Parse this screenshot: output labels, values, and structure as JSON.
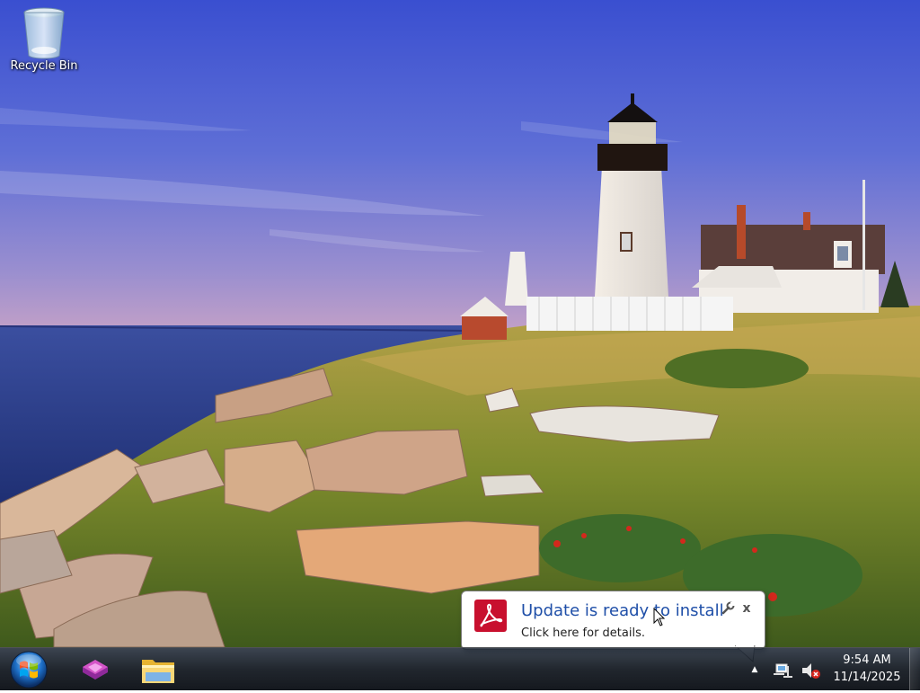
{
  "desktop": {
    "icons": [
      {
        "label": "Recycle Bin",
        "icon": "recycle-bin-icon"
      }
    ],
    "wallpaper": "lighthouse-coast"
  },
  "taskbar": {
    "start_button": {
      "icon": "windows-logo-icon"
    },
    "pinned": [
      {
        "icon": "visual-studio-icon"
      },
      {
        "icon": "file-explorer-folder-icon"
      }
    ],
    "tray": {
      "overflow_icon": "show-hidden-icons-arrow",
      "network_icon": "network-icon",
      "volume_icon": "volume-muted-icon",
      "time": "9:54 AM",
      "date": "11/14/2025"
    }
  },
  "notification": {
    "app_icon": "adobe-acrobat-icon",
    "title": "Update is ready to install",
    "text": "Click here for details.",
    "options_icon": "wrench-icon",
    "close_label": "x"
  },
  "colors": {
    "notification_title": "#1f4fa8",
    "acrobat_red": "#c8102e",
    "taskbar": "#0e141c"
  }
}
